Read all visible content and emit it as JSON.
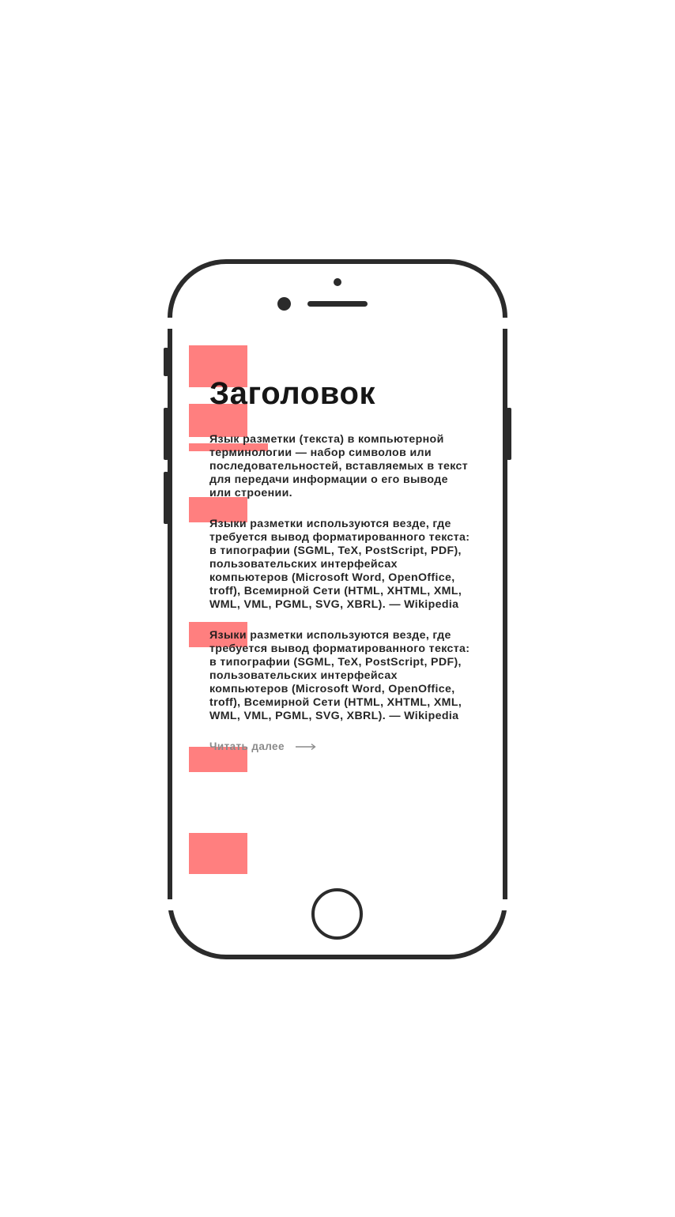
{
  "article": {
    "title": "Заголовок",
    "paragraphs": [
      "Язык разметки (текста) в компьютерной терминологии — набор символов или последовательностей, вставляемых в текст для передачи информации о его выводе или строении.",
      "Языки разметки используются везде, где требуется вывод форматированного текста: в типографии (SGML, TeX, PostScript, PDF), пользовательских интерфейсах компьютеров (Microsoft Word, OpenOffice, troff), Всемирной Сети (HTML, XHTML, XML, WML, VML, PGML, SVG, XBRL). — Wikipedia",
      "Языки разметки используются везде, где требуется вывод форматированного текста: в типографии (SGML, TeX, PostScript, PDF), пользовательских интерфейсах компьютеров (Microsoft Word, OpenOffice, troff), Всемирной Сети (HTML, XHTML, XML, WML, VML, PGML, SVG, XBRL). — Wikipedia"
    ],
    "read_more_label": "Читать далее",
    "read_more_icon": "arrow-right-icon"
  },
  "colors": {
    "frame": "#2b2b2b",
    "marker": "#ff7f7f",
    "text": "#111111",
    "muted": "#8a8a8a"
  }
}
